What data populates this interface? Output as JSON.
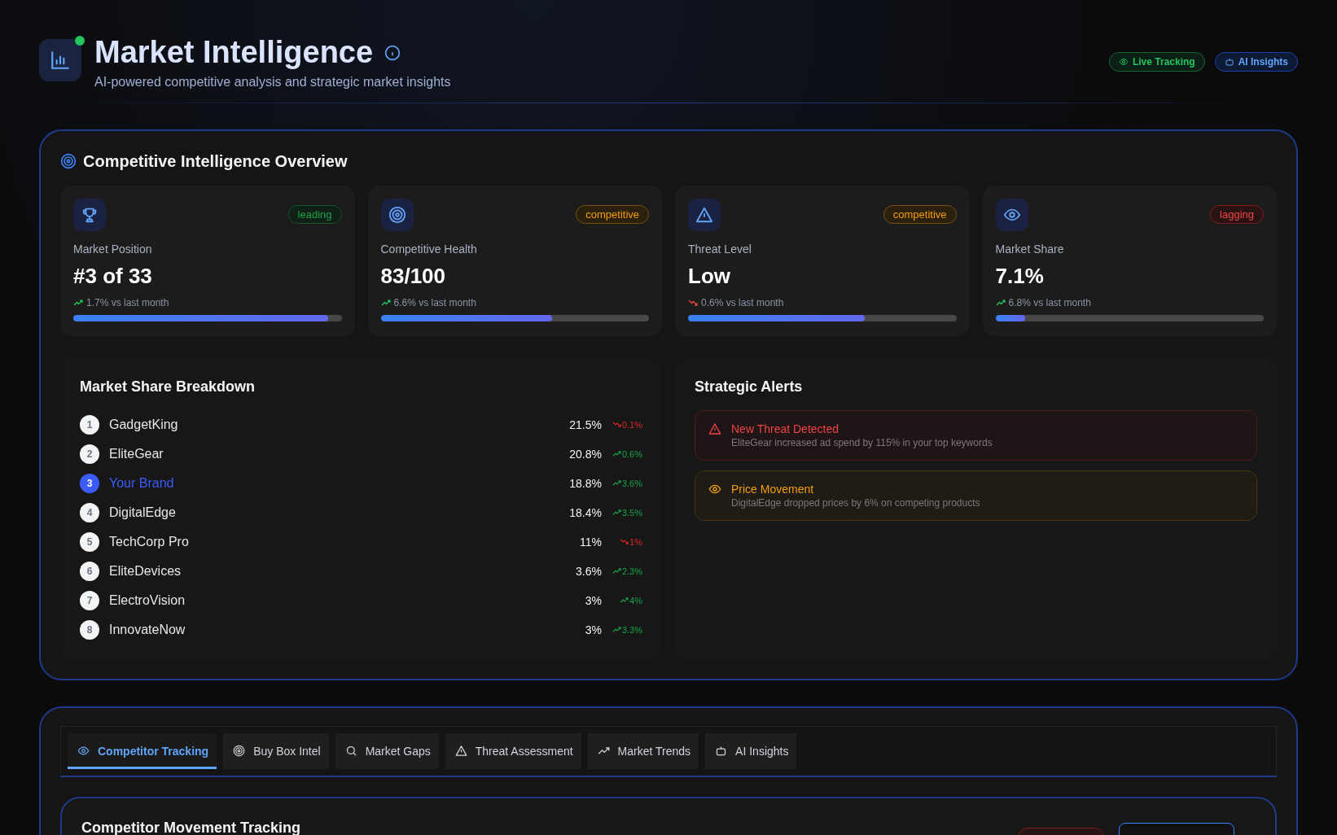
{
  "header": {
    "title": "Market Intelligence",
    "subtitle": "AI-powered competitive analysis and strategic market insights",
    "live": true,
    "badges": [
      {
        "label": "Live Tracking",
        "kind": "live"
      },
      {
        "label": "AI Insights",
        "kind": "ai"
      }
    ]
  },
  "overview": {
    "title": "Competitive Intelligence Overview",
    "cards": [
      {
        "kind": "trophy",
        "status": "leading",
        "label": "Market Position",
        "value": "#3 of 33",
        "rising": true,
        "change": "1.7% vs last month",
        "level": 0.95
      },
      {
        "kind": "target",
        "status": "competitive",
        "label": "Competitive Health",
        "value": "83/100",
        "rising": true,
        "change": "6.6% vs last month",
        "level": 0.64
      },
      {
        "kind": "warning",
        "status": "competitive",
        "label": "Threat Level",
        "value": "Low",
        "rising": false,
        "change": "0.6% vs last month",
        "level": 0.66
      },
      {
        "kind": "eye",
        "status": "lagging",
        "label": "Market Share",
        "value": "7.1%",
        "rising": true,
        "change": "6.8% vs last month",
        "level": 0.11
      }
    ],
    "breakdown": {
      "title": "Market Share Breakdown",
      "rows": [
        {
          "rank": "1",
          "name": "GadgetKing",
          "share": "21.5%",
          "rising": false,
          "change": "0.1%",
          "selected": false
        },
        {
          "rank": "2",
          "name": "EliteGear",
          "share": "20.8%",
          "rising": true,
          "change": "0.6%",
          "selected": false
        },
        {
          "rank": "3",
          "name": "Your Brand",
          "share": "18.8%",
          "rising": true,
          "change": "3.6%",
          "selected": true
        },
        {
          "rank": "4",
          "name": "DigitalEdge",
          "share": "18.4%",
          "rising": true,
          "change": "3.5%",
          "selected": false
        },
        {
          "rank": "5",
          "name": "TechCorp Pro",
          "share": "11%",
          "rising": false,
          "change": "1%",
          "selected": false
        },
        {
          "rank": "6",
          "name": "EliteDevices",
          "share": "3.6%",
          "rising": true,
          "change": "2.3%",
          "selected": false
        },
        {
          "rank": "7",
          "name": "ElectroVision",
          "share": "3%",
          "rising": true,
          "change": "4%",
          "selected": false
        },
        {
          "rank": "8",
          "name": "InnovateNow",
          "share": "3%",
          "rising": true,
          "change": "3.3%",
          "selected": false
        }
      ]
    },
    "alerts": {
      "title": "Strategic Alerts",
      "items": [
        {
          "kind": "threat",
          "title": "New Threat Detected",
          "text": "EliteGear increased ad spend by 115% in your top keywords"
        },
        {
          "kind": "price",
          "title": "Price Movement",
          "text": "DigitalEdge dropped prices by 6% on competing products"
        }
      ]
    }
  },
  "tabs": [
    {
      "label": "Competitor Tracking",
      "kind": "eye",
      "selected": true
    },
    {
      "label": "Buy Box Intel",
      "kind": "target",
      "selected": false
    },
    {
      "label": "Market Gaps",
      "kind": "search",
      "selected": false
    },
    {
      "label": "Threat Assessment",
      "kind": "warning",
      "selected": false
    },
    {
      "label": "Market Trends",
      "kind": "trend",
      "selected": false
    },
    {
      "label": "AI Insights",
      "kind": "bot",
      "selected": false
    }
  ],
  "tracking": {
    "title": "Competitor Movement Tracking"
  }
}
